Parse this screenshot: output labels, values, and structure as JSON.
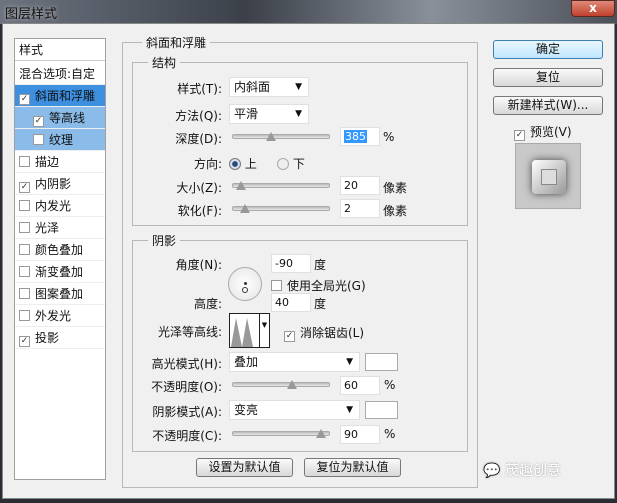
{
  "window": {
    "title": "图层样式",
    "close_label": "x"
  },
  "sidebar": {
    "header": "样式",
    "blend_options": "混合选项:自定",
    "items": [
      {
        "label": "斜面和浮雕",
        "checked": true,
        "selected": true,
        "sub": false
      },
      {
        "label": "等高线",
        "checked": true,
        "selected": false,
        "sub": true
      },
      {
        "label": "纹理",
        "checked": false,
        "selected": false,
        "sub": true
      },
      {
        "label": "描边",
        "checked": false
      },
      {
        "label": "内阴影",
        "checked": true
      },
      {
        "label": "内发光",
        "checked": false
      },
      {
        "label": "光泽",
        "checked": false
      },
      {
        "label": "颜色叠加",
        "checked": false
      },
      {
        "label": "渐变叠加",
        "checked": false
      },
      {
        "label": "图案叠加",
        "checked": false
      },
      {
        "label": "外发光",
        "checked": false
      },
      {
        "label": "投影",
        "checked": true
      }
    ]
  },
  "bevel": {
    "title": "斜面和浮雕",
    "structure": {
      "title": "结构",
      "style_label": "样式(T):",
      "style_value": "内斜面",
      "technique_label": "方法(Q):",
      "technique_value": "平滑",
      "depth_label": "深度(D):",
      "depth_value": "385",
      "depth_unit": "%",
      "depth_fraction": 0.385,
      "direction_label": "方向:",
      "dir_up": "上",
      "dir_down": "下",
      "size_label": "大小(Z):",
      "size_value": "20",
      "size_unit": "像素",
      "size_fraction": 0.08,
      "soften_label": "软化(F):",
      "soften_value": "2",
      "soften_unit": "像素",
      "soften_fraction": 0.125
    },
    "shading": {
      "title": "阴影",
      "angle_label": "角度(N):",
      "angle_value": "-90",
      "angle_unit": "度",
      "global_light": "使用全局光(G)",
      "altitude_label": "高度:",
      "altitude_value": "40",
      "altitude_unit": "度",
      "gloss_label": "光泽等高线:",
      "antialias": "消除锯齿(L)",
      "highlight_label": "高光模式(H):",
      "highlight_mode": "叠加",
      "highlight_color": "#ffffff",
      "hl_opacity_label": "不透明度(O):",
      "hl_opacity": "60",
      "hl_unit": "%",
      "hl_fraction": 0.6,
      "shadow_label": "阴影模式(A):",
      "shadow_mode": "变亮",
      "shadow_color": "#ffffff",
      "sh_opacity_label": "不透明度(C):",
      "sh_opacity": "90",
      "sh_unit": "%",
      "sh_fraction": 0.9
    },
    "make_default": "设置为默认值",
    "reset_default": "复位为默认值"
  },
  "actions": {
    "ok": "确定",
    "reset": "复位",
    "new_style": "新建样式(W)...",
    "preview": "预览(V)"
  },
  "watermark": "茂趣创意"
}
